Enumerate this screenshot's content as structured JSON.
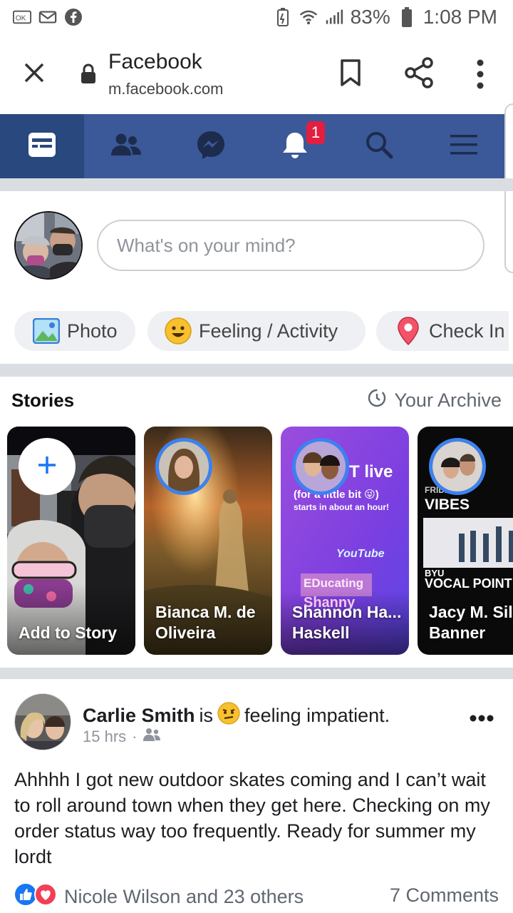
{
  "status_bar": {
    "battery": "83%",
    "time": "1:08 PM"
  },
  "browser": {
    "title": "Facebook",
    "url": "m.facebook.com"
  },
  "nav": {
    "notification_count": "1"
  },
  "composer": {
    "placeholder": "What's on your mind?"
  },
  "actions": {
    "photo": "Photo",
    "feeling": "Feeling / Activity",
    "checkin": "Check In"
  },
  "stories": {
    "title": "Stories",
    "archive": "Your Archive",
    "items": [
      {
        "name": "Add to Story"
      },
      {
        "name": "Bianca M. de Oliveira"
      },
      {
        "name": "Shannon Ha... Haskell",
        "text_live": "T live",
        "text_sub": "(for a little bit 😜)",
        "text_starts": "starts in about an hour!",
        "text_youtube": "YouTube",
        "text_edu": "EDucating",
        "text_shanny": "Shanny"
      },
      {
        "name": "Jacy M. Sil Banner",
        "text_friday": "FRIDAY",
        "text_vibes": "VIBES",
        "text_byu": "BYU",
        "text_vocal": "VOCAL POINT"
      }
    ]
  },
  "post": {
    "author": "Carlie Smith",
    "is": "is",
    "feeling": "feeling impatient.",
    "time": "15 hrs",
    "body": "Ahhhh I got new outdoor skates coming and I can’t wait to roll around town when they get here. Checking on my order status way too frequently. Ready for summer my lordt",
    "reactions": "Nicole Wilson and 23 others",
    "comments": "7 Comments"
  },
  "colors": {
    "fb_blue": "#3b5998",
    "fb_blue_dark": "#29487d",
    "badge_red": "#e41e3f"
  }
}
